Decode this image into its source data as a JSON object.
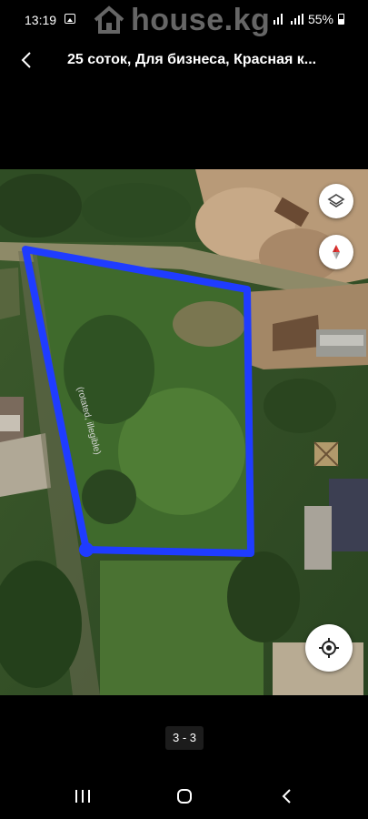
{
  "status_bar": {
    "time": "13:19",
    "battery": "55%",
    "icons": [
      "image-icon",
      "signal-icon",
      "battery-icon"
    ]
  },
  "watermark": {
    "text": "house.kg",
    "icon": "house-icon"
  },
  "header": {
    "title": "25 соток, Для бизнеса, Красная к...",
    "back_icon": "back-chevron-icon"
  },
  "photo": {
    "type": "satellite-map",
    "parcel_outline_color": "#1f3cff",
    "road_label": "(rotated, illegible)",
    "controls": [
      "layers-icon",
      "compass-icon",
      "my-location-icon"
    ]
  },
  "gallery": {
    "counter": "3 - 3"
  },
  "system_nav": {
    "icons": [
      "recent-apps-icon",
      "home-icon",
      "back-icon"
    ]
  }
}
